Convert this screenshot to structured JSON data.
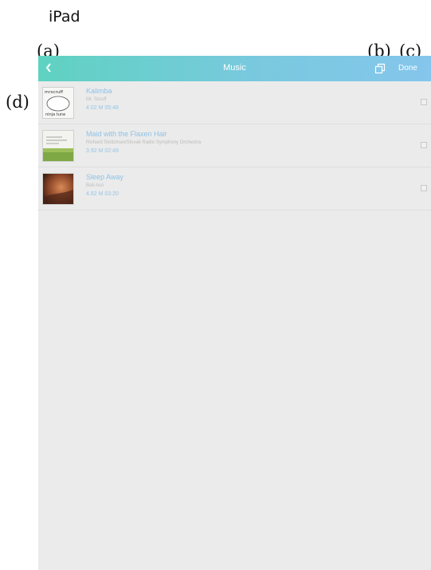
{
  "device_label": "iPad",
  "callouts": {
    "a": "(a)",
    "b": "(b)",
    "c": "(c)",
    "d": "(d)"
  },
  "navbar": {
    "back_icon": "chevron-left-icon",
    "title": "Music",
    "copy_icon": "copy-icon",
    "done_label": "Done",
    "gradient": [
      "#5fd2c1",
      "#85c6ec"
    ]
  },
  "songs": [
    {
      "title": "Kalimba",
      "artist": "Mr. Scruff",
      "meta": "4.02 M 05:48",
      "checked": false
    },
    {
      "title": "Maid with the Flaxen Hair",
      "artist": "Richard Stoltzman/Slovak Radio Symphony Orchestra",
      "meta": "3.92 M 02:49",
      "checked": false
    },
    {
      "title": "Sleep Away",
      "artist": "Bob Acri",
      "meta": "4.62 M 03:20",
      "checked": false
    }
  ]
}
